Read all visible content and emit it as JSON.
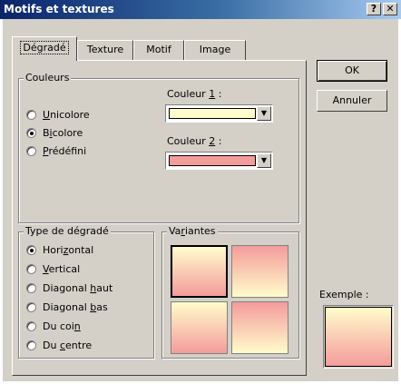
{
  "window": {
    "title": "Motifs et textures",
    "help_glyph": "?",
    "close_glyph": "✕"
  },
  "tabs": [
    {
      "label": "Dégradé",
      "active": true
    },
    {
      "label": "Texture",
      "active": false
    },
    {
      "label": "Motif",
      "active": false
    },
    {
      "label": "Image",
      "active": false
    }
  ],
  "colors_group": {
    "legend": "Couleurs",
    "options": [
      {
        "pre": "",
        "u": "U",
        "post": "nicolore",
        "checked": false
      },
      {
        "pre": "B",
        "u": "i",
        "post": "colore",
        "checked": true
      },
      {
        "pre": "",
        "u": "P",
        "post": "rédéfini",
        "checked": false
      }
    ],
    "color1_label": {
      "pre": "Couleur ",
      "u": "1",
      "post": " :"
    },
    "color2_label": {
      "pre": "Couleur ",
      "u": "2",
      "post": " :"
    },
    "color1_value": "#fffccb",
    "color2_value": "#f49c9c",
    "dropdown_glyph": "▼"
  },
  "gradient_type_group": {
    "legend": "Type de dégradé",
    "options": [
      {
        "pre": "Hori",
        "u": "z",
        "post": "ontal",
        "checked": true
      },
      {
        "pre": "",
        "u": "V",
        "post": "ertical",
        "checked": false
      },
      {
        "pre": "Diagonal ",
        "u": "h",
        "post": "aut",
        "checked": false
      },
      {
        "pre": "Diagonal ",
        "u": "b",
        "post": "as",
        "checked": false
      },
      {
        "pre": "Du coi",
        "u": "n",
        "post": "",
        "checked": false
      },
      {
        "pre": "Du ",
        "u": "c",
        "post": "entre",
        "checked": false
      }
    ]
  },
  "variants_group": {
    "legend_pre": "Va",
    "legend_u": "r",
    "legend_post": "iantes",
    "selected_index": 0
  },
  "buttons": {
    "ok": "OK",
    "cancel": "Annuler"
  },
  "preview": {
    "label": "Exemple :"
  }
}
